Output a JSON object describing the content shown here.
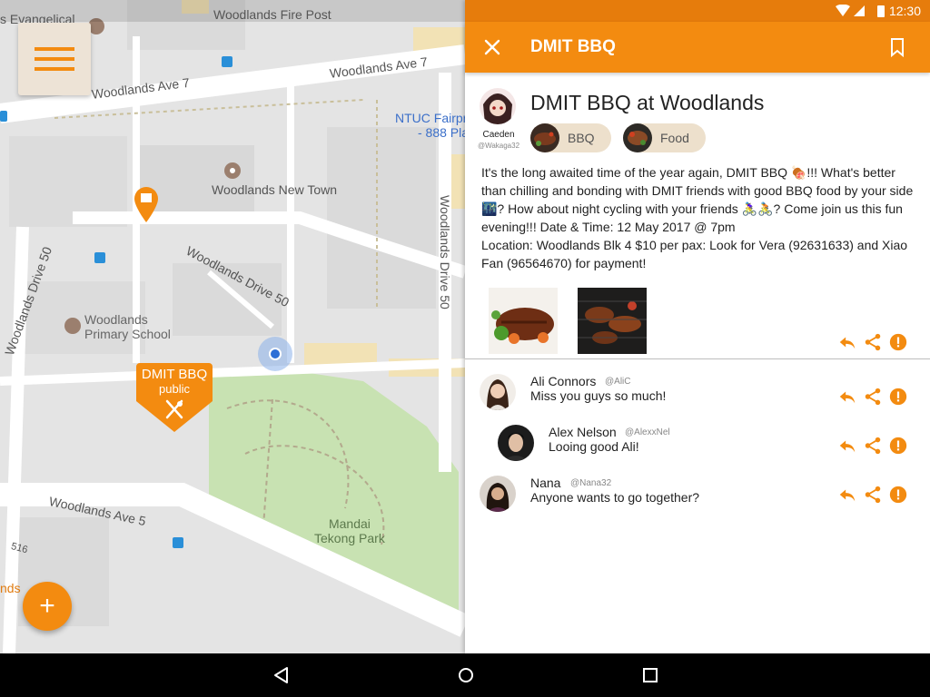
{
  "map": {
    "labels": {
      "fire_post": "Woodlands Fire Post",
      "ave7_right": "Woodlands Ave 7",
      "ave7_left": "Woodlands Ave 7",
      "evangelical": "s Evangelical",
      "ntuc": "NTUC Fairpr",
      "ntuc2": "- 888 Pla",
      "new_town": "Woodlands New Town",
      "drive50_mid": "Woodlands Drive 50",
      "drive50_left": "Woodlands Drive 50",
      "drive50_right": "Woodlands Drive 50",
      "primary_school": "Woodlands\nPrimary School",
      "ave5": "Woodlands Ave 5",
      "park": "Mandai\nTekong Park",
      "num516": "516",
      "nds": "nds"
    },
    "marker": {
      "title": "DMIT BBQ",
      "subtitle": "public"
    }
  },
  "status_bar": {
    "time": "12:30"
  },
  "app_bar": {
    "title": "DMIT BBQ"
  },
  "post": {
    "author": "Caeden",
    "handle": "@Wakaga32",
    "title": "DMIT BBQ at Woodlands",
    "tags": [
      {
        "label": "BBQ"
      },
      {
        "label": "Food"
      }
    ],
    "body": "It's the long awaited time of the year again, DMIT BBQ 🍖!!! What's better than chilling and bonding with DMIT friends with good BBQ food by your side 🌃? How about night cycling with your friends 🚴‍♀️🚴? Come join us this fun evening!!! Date & Time: 12 May 2017 @ 7pm\nLocation: Woodlands Blk 4 $10 per pax: Look for Vera (92631633) and Xiao Fan (96564670) for payment!"
  },
  "comments": [
    {
      "name": "Ali Connors",
      "handle": "@AliC",
      "text": "Miss you guys so much!"
    },
    {
      "name": "Alex Nelson",
      "handle": "@AlexxNel",
      "text": "Looing good Ali!"
    },
    {
      "name": "Nana",
      "handle": "@Nana32",
      "text": "Anyone wants to go together?"
    }
  ],
  "colors": {
    "accent": "#f38b10",
    "status": "#e67c0c",
    "chip": "#ede0cc"
  }
}
